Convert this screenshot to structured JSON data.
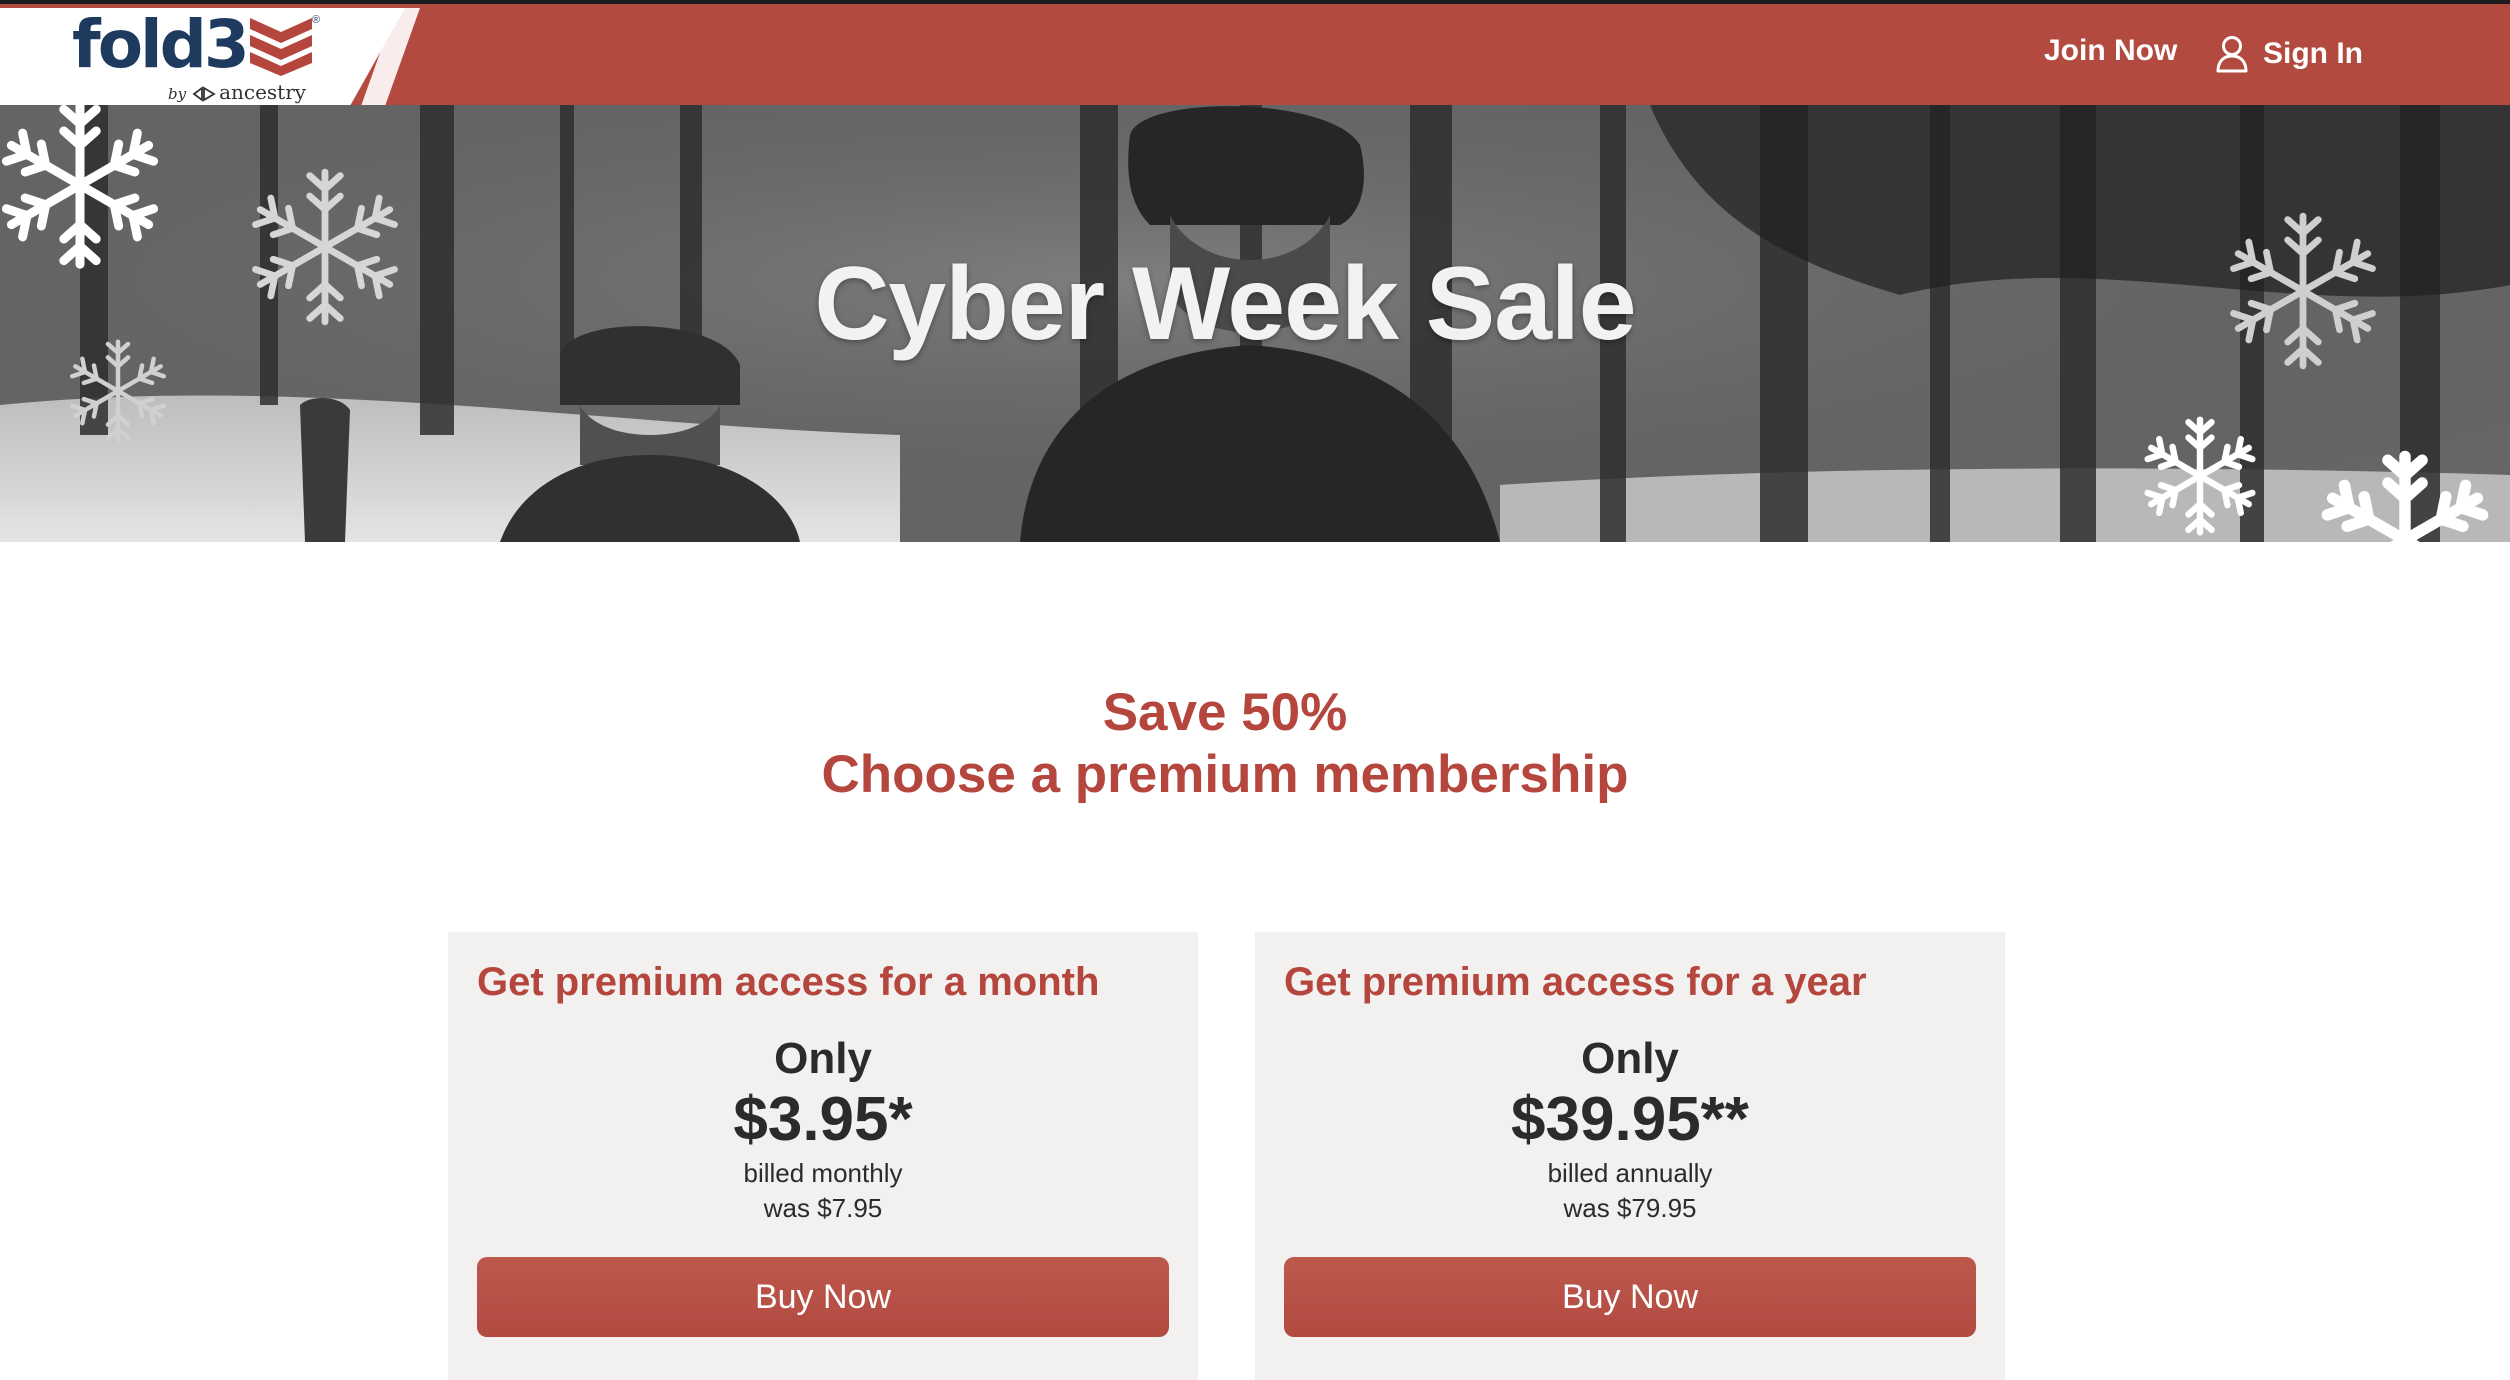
{
  "header": {
    "logo_text": "fold3",
    "logo_by": "by",
    "logo_parent": "ancestry",
    "join_label": "Join Now",
    "signin_label": "Sign In",
    "bar_color": "#b24a40"
  },
  "hero": {
    "title": "Cyber Week Sale"
  },
  "promo": {
    "line1": "Save 50%",
    "line2": "Choose a premium membership",
    "accent_color": "#b5463d"
  },
  "plans": [
    {
      "title": "Get premium access for a month",
      "only": "Only",
      "price": "$3.95*",
      "billing": "billed monthly",
      "was": "was $7.95",
      "button": "Buy Now"
    },
    {
      "title": "Get premium access for a year",
      "only": "Only",
      "price": "$39.95**",
      "billing": "billed annually",
      "was": "was $79.95",
      "button": "Buy Now"
    }
  ],
  "icons": {
    "logo_mark": "fold3-chevron-icon",
    "signin": "user-icon",
    "decoration": "snowflake-icon"
  }
}
